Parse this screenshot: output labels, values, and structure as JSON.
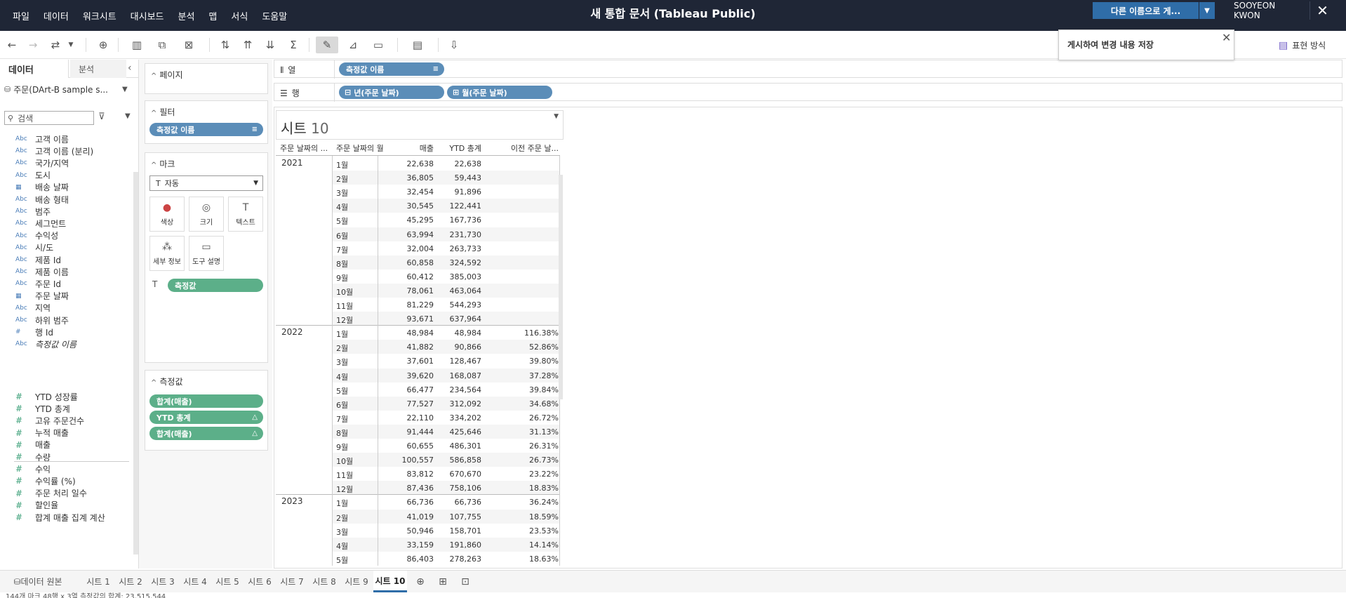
{
  "menu": [
    "파일",
    "데이터",
    "워크시트",
    "대시보드",
    "분석",
    "맵",
    "서식",
    "도움말"
  ],
  "doc_title": "새 통합 문서 (Tableau Public)",
  "save_as_label": "다른 이름으로 게...",
  "user": {
    "first": "SOOYEON",
    "last": "KWON"
  },
  "publish_tip": "게시하여 변경 내용 저장",
  "presentation_label": "표현 방식",
  "data_pane": {
    "tab_data": "데이터",
    "tab_analysis": "분석",
    "datasource": "주문(DArt-B sample s...",
    "search_placeholder": "검색",
    "dimensions": [
      {
        "type": "Abc",
        "name": "고객 이름"
      },
      {
        "type": "Abc",
        "name": "고객 이름 (분리)"
      },
      {
        "type": "Abc",
        "name": "국가/지역"
      },
      {
        "type": "Abc",
        "name": "도시"
      },
      {
        "type": "date",
        "name": "배송 날짜"
      },
      {
        "type": "Abc",
        "name": "배송 형태"
      },
      {
        "type": "Abc",
        "name": "범주"
      },
      {
        "type": "Abc",
        "name": "세그먼트"
      },
      {
        "type": "Abc",
        "name": "수익성"
      },
      {
        "type": "Abc",
        "name": "시/도"
      },
      {
        "type": "Abc",
        "name": "제품 Id"
      },
      {
        "type": "Abc",
        "name": "제품 이름"
      },
      {
        "type": "Abc",
        "name": "주문 Id"
      },
      {
        "type": "date",
        "name": "주문 날짜"
      },
      {
        "type": "Abc",
        "name": "지역"
      },
      {
        "type": "Abc",
        "name": "하위 범주"
      },
      {
        "type": "#",
        "name": "행 Id"
      },
      {
        "type": "Abc",
        "name": "측정값 이름"
      }
    ],
    "measures": [
      {
        "type": "#",
        "name": "YTD 성장률"
      },
      {
        "type": "#",
        "name": "YTD 총계"
      },
      {
        "type": "#",
        "name": "고유 주문건수"
      },
      {
        "type": "#",
        "name": "누적 매출"
      },
      {
        "type": "#",
        "name": "매출"
      },
      {
        "type": "#",
        "name": "수량"
      },
      {
        "type": "#",
        "name": "수익"
      },
      {
        "type": "#",
        "name": "수익률 (%)"
      },
      {
        "type": "#",
        "name": "주문 처리 일수"
      },
      {
        "type": "#",
        "name": "할인율"
      },
      {
        "type": "#",
        "name": "합계 매출 집계 계산"
      }
    ]
  },
  "cards": {
    "pages": "페이지",
    "filters": "필터",
    "filter_pill": "측정값 이름",
    "marks": "마크",
    "mark_type": "자동",
    "mark_buttons": [
      "색상",
      "크기",
      "텍스트",
      "세부 정보",
      "도구 설명"
    ],
    "marks_pill": "측정값",
    "measure_values": "측정값",
    "measure_pills": [
      "합계(매출)",
      "YTD 총계",
      "합계(매출)"
    ]
  },
  "shelves": {
    "columns_label": "열",
    "columns_pill": "측정값 이름",
    "rows_label": "행",
    "rows_pills": [
      "년(주문 날짜)",
      "월(주문 날짜)"
    ]
  },
  "sheet": {
    "title": "시트",
    "title_num": "10",
    "headers": [
      "주문 날짜의 ...",
      "주문 날짜의 월",
      "매출",
      "YTD 총계",
      "이전 주문 날..."
    ],
    "years": [
      {
        "year": "2021",
        "rows": [
          [
            "1월",
            "22,638",
            "22,638",
            ""
          ],
          [
            "2월",
            "36,805",
            "59,443",
            ""
          ],
          [
            "3월",
            "32,454",
            "91,896",
            ""
          ],
          [
            "4월",
            "30,545",
            "122,441",
            ""
          ],
          [
            "5월",
            "45,295",
            "167,736",
            ""
          ],
          [
            "6월",
            "63,994",
            "231,730",
            ""
          ],
          [
            "7월",
            "32,004",
            "263,733",
            ""
          ],
          [
            "8월",
            "60,858",
            "324,592",
            ""
          ],
          [
            "9월",
            "60,412",
            "385,003",
            ""
          ],
          [
            "10월",
            "78,061",
            "463,064",
            ""
          ],
          [
            "11월",
            "81,229",
            "544,293",
            ""
          ],
          [
            "12월",
            "93,671",
            "637,964",
            ""
          ]
        ]
      },
      {
        "year": "2022",
        "rows": [
          [
            "1월",
            "48,984",
            "48,984",
            "116.38%"
          ],
          [
            "2월",
            "41,882",
            "90,866",
            "52.86%"
          ],
          [
            "3월",
            "37,601",
            "128,467",
            "39.80%"
          ],
          [
            "4월",
            "39,620",
            "168,087",
            "37.28%"
          ],
          [
            "5월",
            "66,477",
            "234,564",
            "39.84%"
          ],
          [
            "6월",
            "77,527",
            "312,092",
            "34.68%"
          ],
          [
            "7월",
            "22,110",
            "334,202",
            "26.72%"
          ],
          [
            "8월",
            "91,444",
            "425,646",
            "31.13%"
          ],
          [
            "9월",
            "60,655",
            "486,301",
            "26.31%"
          ],
          [
            "10월",
            "100,557",
            "586,858",
            "26.73%"
          ],
          [
            "11월",
            "83,812",
            "670,670",
            "23.22%"
          ],
          [
            "12월",
            "87,436",
            "758,106",
            "18.83%"
          ]
        ]
      },
      {
        "year": "2023",
        "rows": [
          [
            "1월",
            "66,736",
            "66,736",
            "36.24%"
          ],
          [
            "2월",
            "41,019",
            "107,755",
            "18.59%"
          ],
          [
            "3월",
            "50,946",
            "158,701",
            "23.53%"
          ],
          [
            "4월",
            "33,159",
            "191,860",
            "14.14%"
          ],
          [
            "5월",
            "86,403",
            "278,263",
            "18.63%"
          ]
        ]
      }
    ]
  },
  "tabs": {
    "data_source": "데이터 원본",
    "sheets": [
      "시트 1",
      "시트 2",
      "시트 3",
      "시트 4",
      "시트 5",
      "시트 6",
      "시트 7",
      "시트 8",
      "시트 9",
      "시트 10"
    ],
    "active": "시트 10"
  },
  "status_text": "144개 마크   48행 x 3열   측정값의 합계: 23,515,544",
  "colors": {
    "topbar": "#1f2636",
    "accent": "#2f6da8",
    "dimension_pill": "#5b8db8",
    "measure_pill": "#5caf89"
  }
}
